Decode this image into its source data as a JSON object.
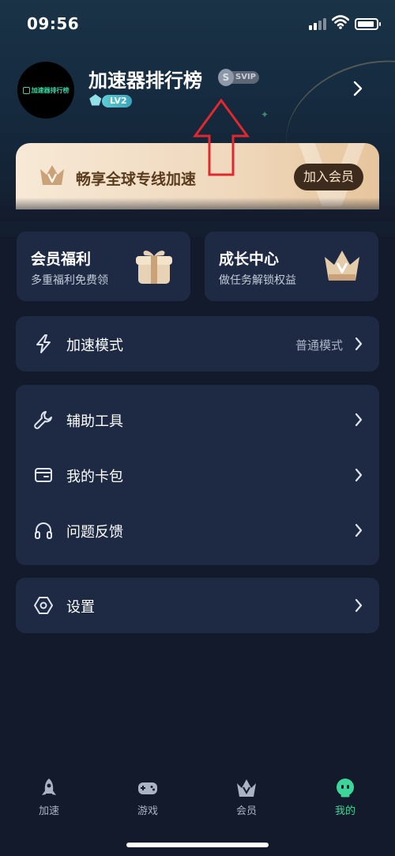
{
  "status_bar": {
    "time": "09:56"
  },
  "profile": {
    "avatar_text": "加速器排行榜",
    "username": "加速器排行榜",
    "vip_badge": "SVIP",
    "level": "LV2"
  },
  "banner": {
    "text": "畅享全球专线加速",
    "button": "加入会员"
  },
  "cards": [
    {
      "title": "会员福利",
      "subtitle": "多重福利免费领",
      "icon": "gift-icon"
    },
    {
      "title": "成长中心",
      "subtitle": "做任务解锁权益",
      "icon": "crown-icon"
    }
  ],
  "mode_row": {
    "label": "加速模式",
    "value": "普通模式",
    "icon": "lightning-icon"
  },
  "menu": [
    {
      "label": "辅助工具",
      "icon": "wrench-icon"
    },
    {
      "label": "我的卡包",
      "icon": "wallet-icon"
    },
    {
      "label": "问题反馈",
      "icon": "headphones-icon"
    }
  ],
  "settings_row": {
    "label": "设置",
    "icon": "settings-icon"
  },
  "tabbar": [
    {
      "label": "加速",
      "icon": "rocket-icon",
      "active": false
    },
    {
      "label": "游戏",
      "icon": "gamepad-icon",
      "active": false
    },
    {
      "label": "会员",
      "icon": "crown-icon",
      "active": false
    },
    {
      "label": "我的",
      "icon": "profile-face-icon",
      "active": true
    }
  ],
  "colors": {
    "background": "#131a2b",
    "card": "#1e2a44",
    "accent_green": "#3ed59a",
    "banner_gold": "#efd8bc",
    "annotation_red": "#e0282e"
  }
}
